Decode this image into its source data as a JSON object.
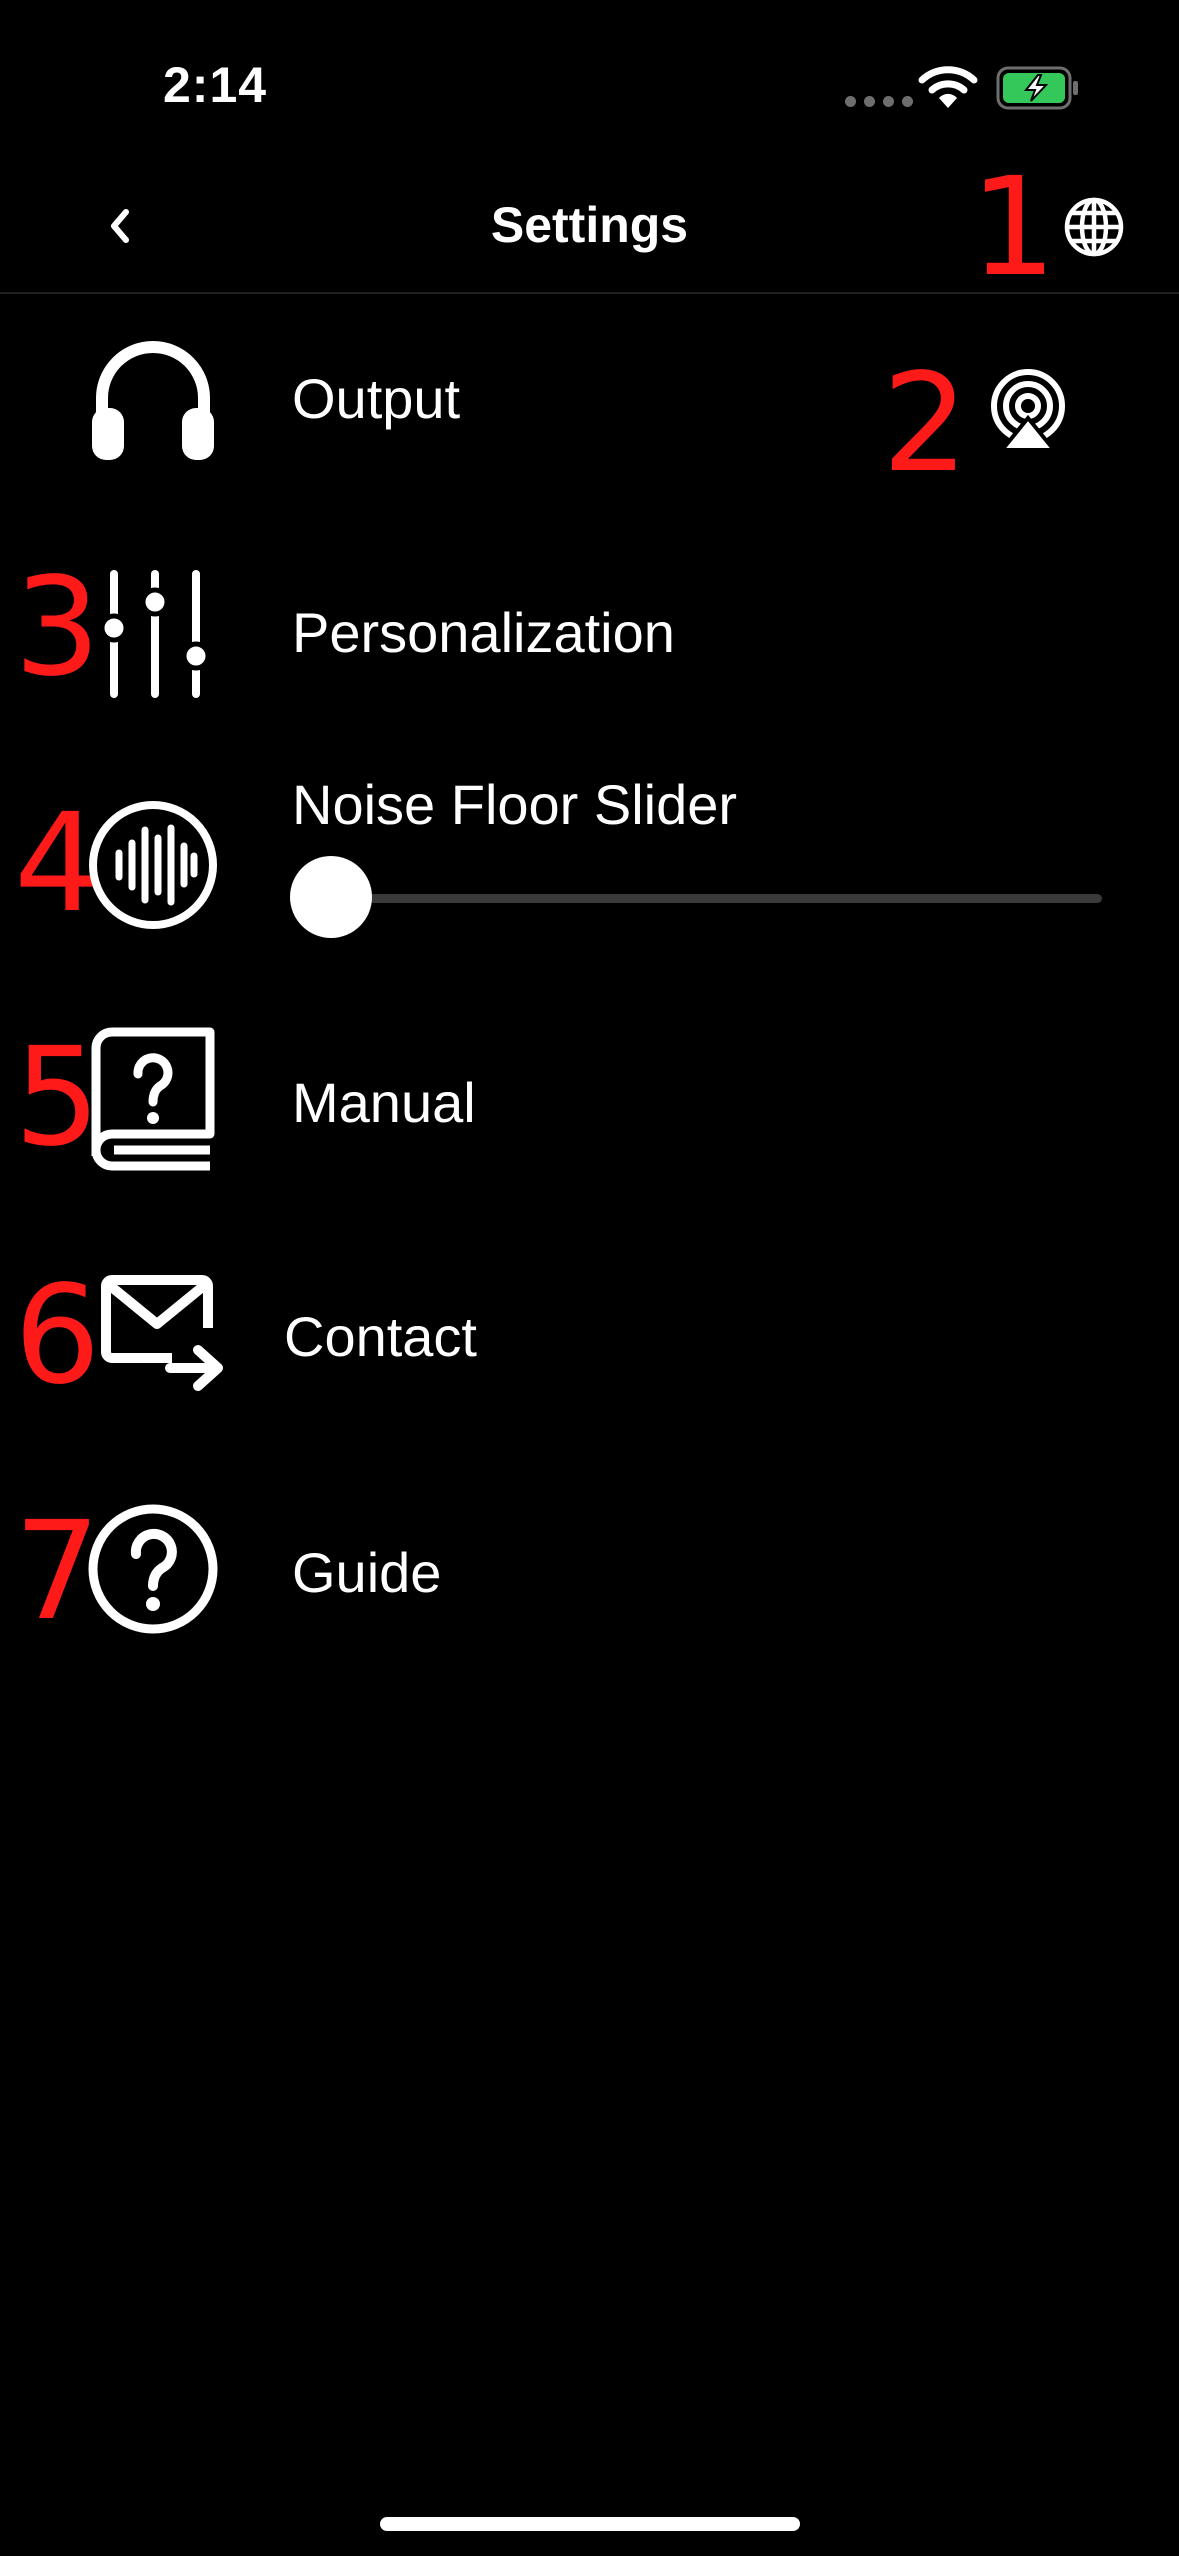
{
  "status_bar": {
    "time": "2:14",
    "battery_color": "#34c759"
  },
  "nav": {
    "title": "Settings",
    "back_icon": "chevron-left-icon",
    "language_icon": "globe-icon"
  },
  "annotations": [
    "1",
    "2",
    "3",
    "4",
    "5",
    "6",
    "7"
  ],
  "rows": {
    "output": {
      "label": "Output",
      "icon": "headphones-icon",
      "accessory_icon": "airplay-audio-icon"
    },
    "personalization": {
      "label": "Personalization",
      "icon": "sliders-icon"
    },
    "noise_floor": {
      "label": "Noise Floor Slider",
      "icon": "waveform-circle-icon",
      "value": 0
    },
    "manual": {
      "label": "Manual",
      "icon": "book-question-icon"
    },
    "contact": {
      "label": "Contact",
      "icon": "mail-forward-icon"
    },
    "guide": {
      "label": "Guide",
      "icon": "question-circle-icon"
    }
  },
  "colors": {
    "background": "#000000",
    "text": "#ffffff",
    "annotation": "#ff1a1a"
  }
}
